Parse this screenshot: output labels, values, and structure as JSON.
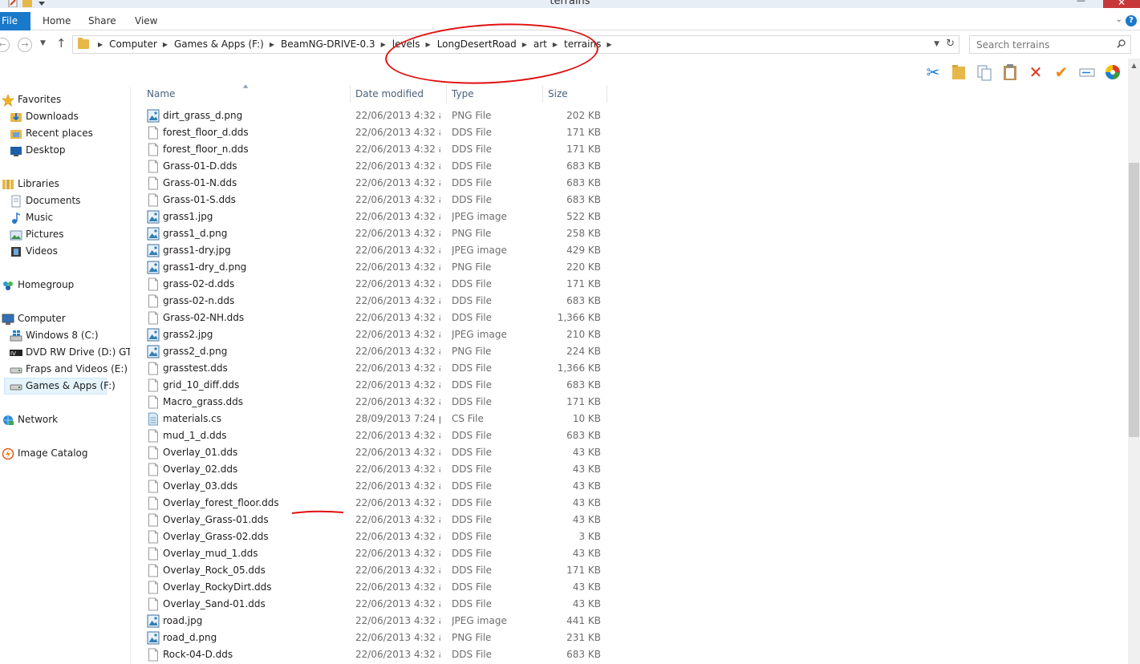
{
  "window": {
    "title": "terrains",
    "close_glyph": "✕",
    "minimize_glyph": "—"
  },
  "ribbon": {
    "tabs": [
      "File",
      "Home",
      "Share",
      "View"
    ],
    "expand_glyph": "⌄",
    "help_glyph": "?"
  },
  "address": {
    "crumbs": [
      "Computer",
      "Games & Apps (F:)",
      "BeamNG-DRIVE-0.3",
      "levels",
      "LongDesertRoad",
      "art",
      "terrains"
    ],
    "separator": "▶",
    "back_glyph": "←",
    "forward_glyph": "→",
    "recent_glyph": "▼",
    "up_glyph": "↑",
    "dropdown_glyph": "▼",
    "refresh_glyph": "↻"
  },
  "search": {
    "placeholder": "Search terrains"
  },
  "toolbar": {
    "icons": [
      "scissors-icon",
      "folder-icon",
      "copy-icon",
      "paste-icon",
      "delete-icon",
      "checkmark-icon",
      "rename-icon",
      "color-wheel-icon"
    ],
    "glyphs": [
      "✂",
      "",
      "",
      "",
      "✕",
      "✔",
      "",
      ""
    ],
    "colors": [
      "#1b7fd6",
      "#e6b84a",
      "#6f8fb0",
      "#b8935a",
      "#e0321f",
      "#f08a1a",
      "#7f8f9f",
      "#3c9a3c"
    ]
  },
  "navpane": {
    "favorites": {
      "label": "Favorites",
      "items": [
        "Downloads",
        "Recent places",
        "Desktop"
      ]
    },
    "libraries": {
      "label": "Libraries",
      "items": [
        "Documents",
        "Music",
        "Pictures",
        "Videos"
      ]
    },
    "homegroup": {
      "label": "Homegroup"
    },
    "computer": {
      "label": "Computer",
      "items": [
        "Windows 8 (C:)",
        "DVD RW Drive (D:) GTA I",
        "Fraps and Videos (E:)",
        "Games & Apps (F:)"
      ]
    },
    "network": {
      "label": "Network"
    },
    "image_catalog": {
      "label": "Image Catalog"
    }
  },
  "columns": {
    "name": "Name",
    "date": "Date modified",
    "type": "Type",
    "size": "Size",
    "sort_glyph": "▲"
  },
  "files": [
    {
      "name": "dirt_grass_d.png",
      "date": "22/06/2013 4:32 a....",
      "type": "PNG File",
      "size": "202 KB",
      "icon": "image"
    },
    {
      "name": "forest_floor_d.dds",
      "date": "22/06/2013 4:32 a....",
      "type": "DDS File",
      "size": "171 KB",
      "icon": "file"
    },
    {
      "name": "forest_floor_n.dds",
      "date": "22/06/2013 4:32 a....",
      "type": "DDS File",
      "size": "171 KB",
      "icon": "file"
    },
    {
      "name": "Grass-01-D.dds",
      "date": "22/06/2013 4:32 a....",
      "type": "DDS File",
      "size": "683 KB",
      "icon": "file"
    },
    {
      "name": "Grass-01-N.dds",
      "date": "22/06/2013 4:32 a....",
      "type": "DDS File",
      "size": "683 KB",
      "icon": "file"
    },
    {
      "name": "Grass-01-S.dds",
      "date": "22/06/2013 4:32 a....",
      "type": "DDS File",
      "size": "683 KB",
      "icon": "file"
    },
    {
      "name": "grass1.jpg",
      "date": "22/06/2013 4:32 a....",
      "type": "JPEG image",
      "size": "522 KB",
      "icon": "image"
    },
    {
      "name": "grass1_d.png",
      "date": "22/06/2013 4:32 a....",
      "type": "PNG File",
      "size": "258 KB",
      "icon": "image"
    },
    {
      "name": "grass1-dry.jpg",
      "date": "22/06/2013 4:32 a....",
      "type": "JPEG image",
      "size": "429 KB",
      "icon": "image"
    },
    {
      "name": "grass1-dry_d.png",
      "date": "22/06/2013 4:32 a....",
      "type": "PNG File",
      "size": "220 KB",
      "icon": "image"
    },
    {
      "name": "grass-02-d.dds",
      "date": "22/06/2013 4:32 a....",
      "type": "DDS File",
      "size": "171 KB",
      "icon": "file"
    },
    {
      "name": "grass-02-n.dds",
      "date": "22/06/2013 4:32 a....",
      "type": "DDS File",
      "size": "683 KB",
      "icon": "file"
    },
    {
      "name": "Grass-02-NH.dds",
      "date": "22/06/2013 4:32 a....",
      "type": "DDS File",
      "size": "1,366 KB",
      "icon": "file"
    },
    {
      "name": "grass2.jpg",
      "date": "22/06/2013 4:32 a....",
      "type": "JPEG image",
      "size": "210 KB",
      "icon": "image"
    },
    {
      "name": "grass2_d.png",
      "date": "22/06/2013 4:32 a....",
      "type": "PNG File",
      "size": "224 KB",
      "icon": "image"
    },
    {
      "name": "grasstest.dds",
      "date": "22/06/2013 4:32 a....",
      "type": "DDS File",
      "size": "1,366 KB",
      "icon": "file"
    },
    {
      "name": "grid_10_diff.dds",
      "date": "22/06/2013 4:32 a....",
      "type": "DDS File",
      "size": "683 KB",
      "icon": "file"
    },
    {
      "name": "Macro_grass.dds",
      "date": "22/06/2013 4:32 a....",
      "type": "DDS File",
      "size": "171 KB",
      "icon": "file"
    },
    {
      "name": "materials.cs",
      "date": "28/09/2013 7:24 p....",
      "type": "CS File",
      "size": "10 KB",
      "icon": "cs"
    },
    {
      "name": "mud_1_d.dds",
      "date": "22/06/2013 4:32 a....",
      "type": "DDS File",
      "size": "683 KB",
      "icon": "file"
    },
    {
      "name": "Overlay_01.dds",
      "date": "22/06/2013 4:32 a....",
      "type": "DDS File",
      "size": "43 KB",
      "icon": "file"
    },
    {
      "name": "Overlay_02.dds",
      "date": "22/06/2013 4:32 a....",
      "type": "DDS File",
      "size": "43 KB",
      "icon": "file"
    },
    {
      "name": "Overlay_03.dds",
      "date": "22/06/2013 4:32 a....",
      "type": "DDS File",
      "size": "43 KB",
      "icon": "file"
    },
    {
      "name": "Overlay_forest_floor.dds",
      "date": "22/06/2013 4:32 a....",
      "type": "DDS File",
      "size": "43 KB",
      "icon": "file"
    },
    {
      "name": "Overlay_Grass-01.dds",
      "date": "22/06/2013 4:32 a....",
      "type": "DDS File",
      "size": "43 KB",
      "icon": "file"
    },
    {
      "name": "Overlay_Grass-02.dds",
      "date": "22/06/2013 4:32 a....",
      "type": "DDS File",
      "size": "3 KB",
      "icon": "file"
    },
    {
      "name": "Overlay_mud_1.dds",
      "date": "22/06/2013 4:32 a....",
      "type": "DDS File",
      "size": "43 KB",
      "icon": "file"
    },
    {
      "name": "Overlay_Rock_05.dds",
      "date": "22/06/2013 4:32 a....",
      "type": "DDS File",
      "size": "171 KB",
      "icon": "file"
    },
    {
      "name": "Overlay_RockyDirt.dds",
      "date": "22/06/2013 4:32 a....",
      "type": "DDS File",
      "size": "43 KB",
      "icon": "file"
    },
    {
      "name": "Overlay_Sand-01.dds",
      "date": "22/06/2013 4:32 a....",
      "type": "DDS File",
      "size": "43 KB",
      "icon": "file"
    },
    {
      "name": "road.jpg",
      "date": "22/06/2013 4:32 a....",
      "type": "JPEG image",
      "size": "441 KB",
      "icon": "image"
    },
    {
      "name": "road_d.png",
      "date": "22/06/2013 4:32 a....",
      "type": "PNG File",
      "size": "231 KB",
      "icon": "image"
    },
    {
      "name": "Rock-04-D.dds",
      "date": "22/06/2013 4:32 a....",
      "type": "DDS File",
      "size": "683 KB",
      "icon": "file"
    }
  ],
  "scrollbar": {
    "up_glyph": "▲"
  },
  "colors": {
    "accent": "#1979ca",
    "annotation": "#e01010",
    "close": "#c7383a"
  }
}
